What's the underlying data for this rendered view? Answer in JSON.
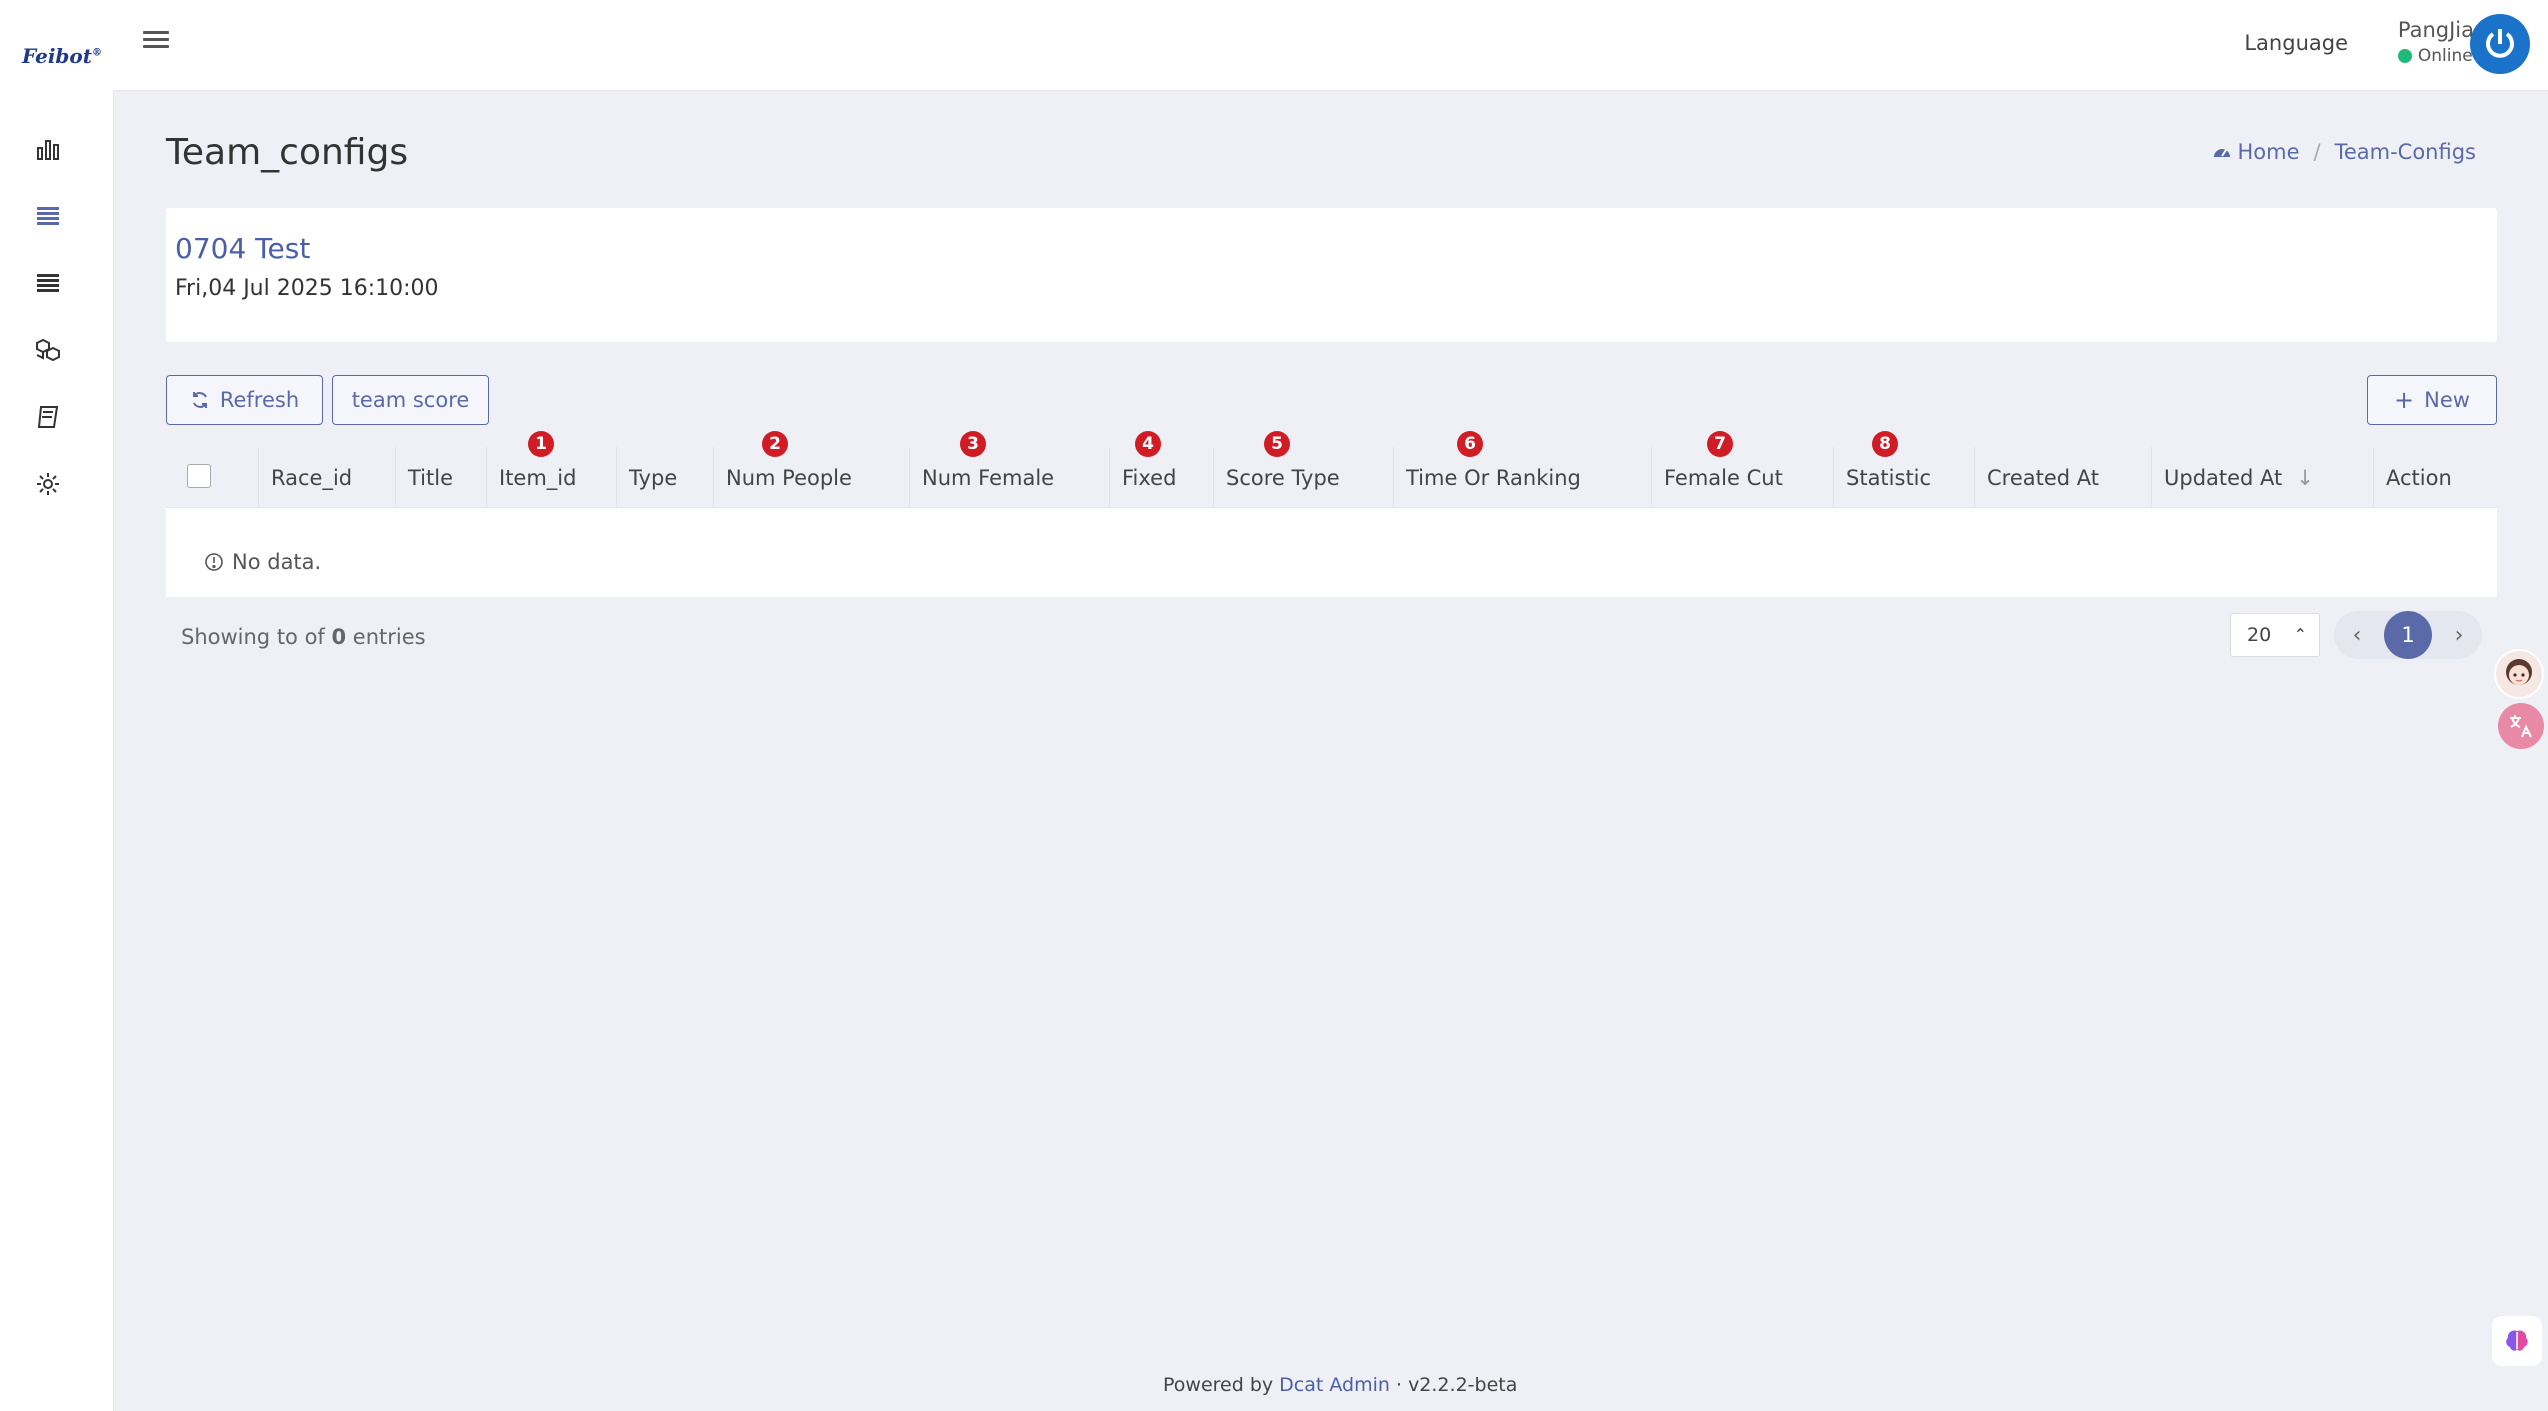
{
  "brand": {
    "name": "Feibot",
    "mark": "®"
  },
  "topbar": {
    "language_label": "Language",
    "user_name": "PangJia",
    "user_status": "Online"
  },
  "page": {
    "title": "Team_configs"
  },
  "breadcrumb": {
    "home": "Home",
    "current": "Team-Configs"
  },
  "race": {
    "title": "0704 Test",
    "date": "Fri,04 Jul 2025 16:10:00"
  },
  "toolbar": {
    "refresh_label": "Refresh",
    "team_score_label": "team score",
    "new_label": "New"
  },
  "table": {
    "columns": [
      "Race_id",
      "Title",
      "Item_id",
      "Type",
      "Num People",
      "Num Female",
      "Fixed",
      "Score Type",
      "Time Or Ranking",
      "Female Cut",
      "Statistic",
      "Created At",
      "Updated At",
      "Action"
    ],
    "badges": [
      "1",
      "2",
      "3",
      "4",
      "5",
      "6",
      "7",
      "8"
    ],
    "empty_text": "No data."
  },
  "pagination": {
    "info_prefix": "Showing to of ",
    "info_count": "0",
    "info_suffix": " entries",
    "per_page": "20",
    "current_page": "1"
  },
  "footer": {
    "prefix": "Powered by ",
    "link": "Dcat Admin",
    "sep": " · ",
    "version": "v2.2.2-beta"
  },
  "colors": {
    "accent": "#5a6aa8",
    "badge": "#d01c25",
    "online": "#21b978",
    "avatar": "#1a73c8"
  }
}
